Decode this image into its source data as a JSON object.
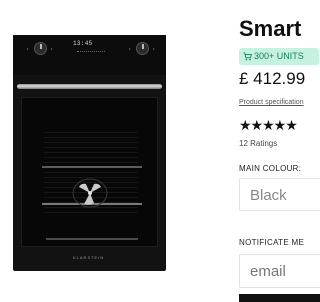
{
  "product_image": {
    "display_time": "13:45",
    "brand_logo": "KLARSTEIN"
  },
  "product": {
    "title": "Smart",
    "stock_badge": "300+ UNITS",
    "price": "£ 412.99",
    "spec_link": "Product specification",
    "stars": "★★★★★",
    "rating_value": 5,
    "ratings_count": "12 Ratings",
    "colour_label": "MAIN COLOUR:",
    "colour_value": "Black",
    "notify_label": "NOTIFICATE ME",
    "email_placeholder": "email"
  },
  "icons": {
    "badge": "cart-icon"
  },
  "colors": {
    "badge_bg": "#c7f1df",
    "badge_text": "#14805c",
    "oven_body": "#121212"
  }
}
